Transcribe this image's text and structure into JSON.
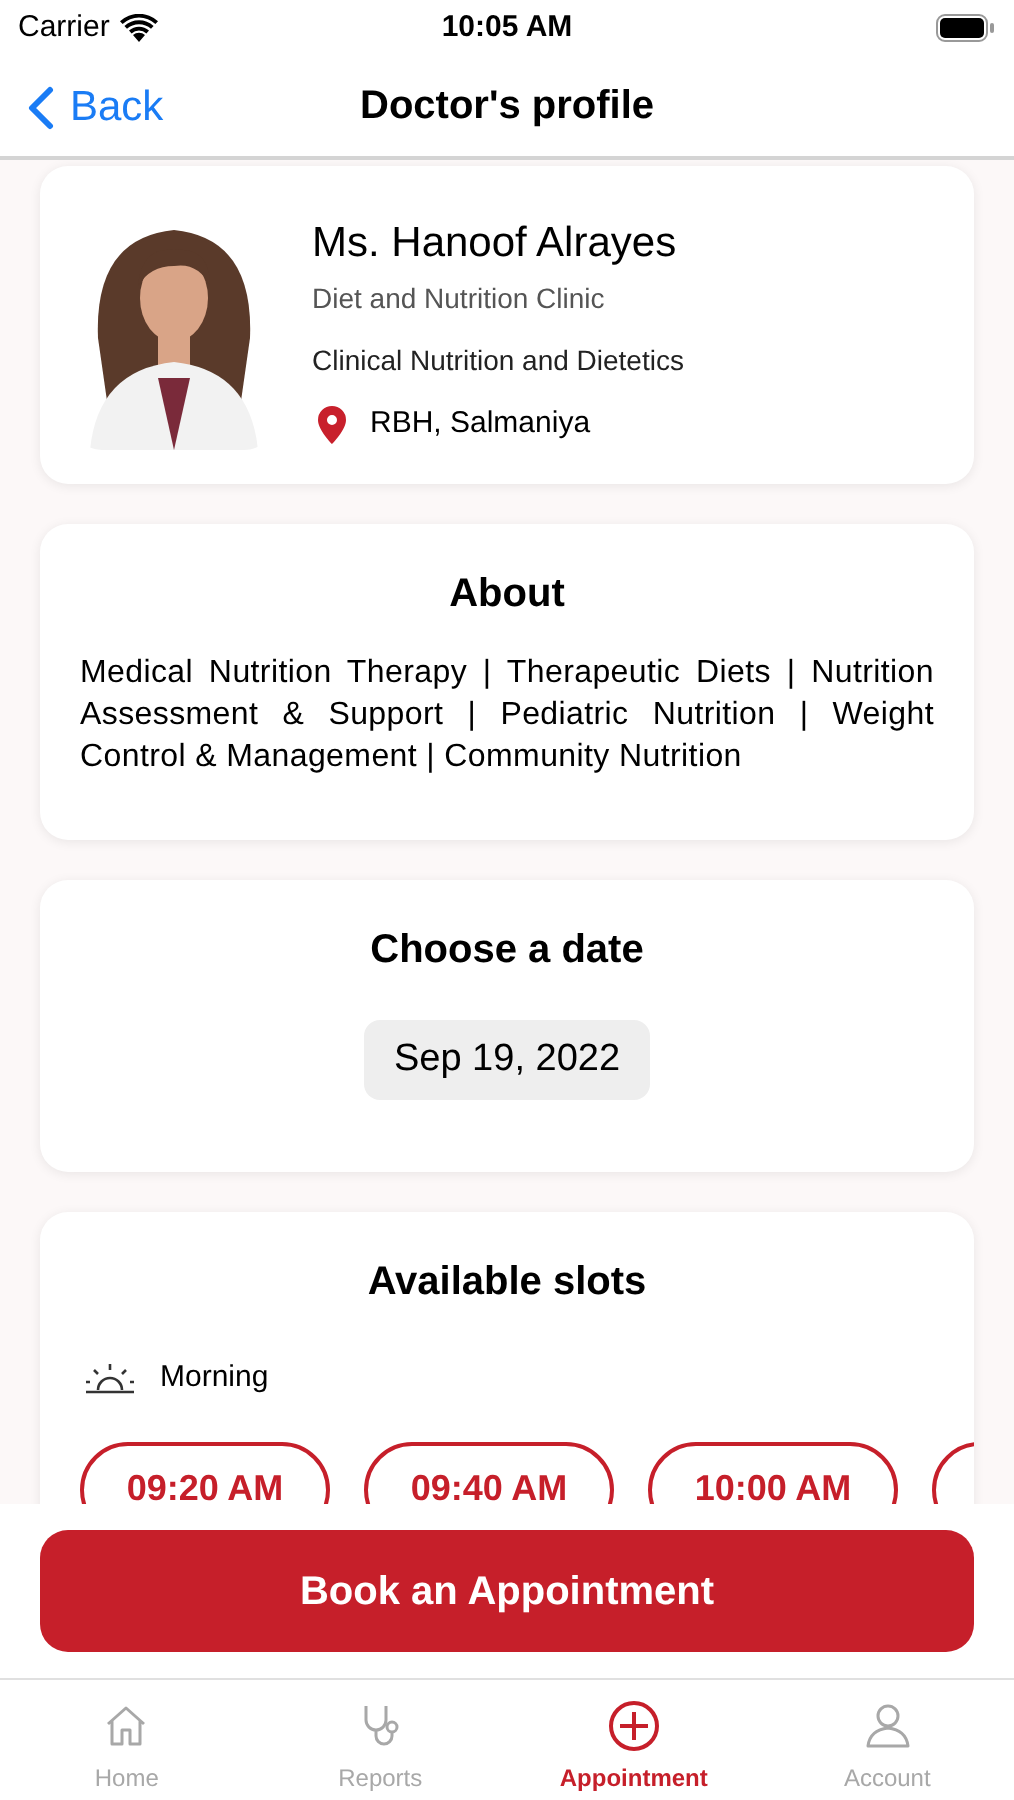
{
  "status_bar": {
    "carrier": "Carrier",
    "time": "10:05 AM"
  },
  "nav": {
    "back": "Back",
    "title": "Doctor's profile"
  },
  "doctor": {
    "name": "Ms. Hanoof Alrayes",
    "clinic": "Diet and Nutrition Clinic",
    "specialty": "Clinical Nutrition and Dietetics",
    "location": "RBH, Salmaniya"
  },
  "about": {
    "title": "About",
    "text": "Medical Nutrition Therapy | Therapeutic Diets | Nutrition Assessment & Support | Pediatric Nutrition | Weight Control & Management | Community Nutrition"
  },
  "date": {
    "title": "Choose a date",
    "value": "Sep 19, 2022"
  },
  "slots": {
    "title": "Available slots",
    "period": "Morning",
    "times": [
      {
        "kind": "time",
        "label": "09:20 AM",
        "selected": false
      },
      {
        "kind": "time",
        "label": "09:40 AM",
        "selected": false
      },
      {
        "kind": "time",
        "label": "10:00 AM",
        "selected": false
      },
      {
        "kind": "cut",
        "selected": false
      }
    ]
  },
  "book_button": "Book an Appointment",
  "tabs": [
    {
      "kind": "home",
      "label": "Home",
      "selected": false
    },
    {
      "kind": "stethoscope",
      "label": "Reports",
      "selected": false
    },
    {
      "kind": "plus",
      "label": "Appointment",
      "selected": true
    },
    {
      "kind": "person",
      "label": "Account",
      "selected": false
    }
  ]
}
